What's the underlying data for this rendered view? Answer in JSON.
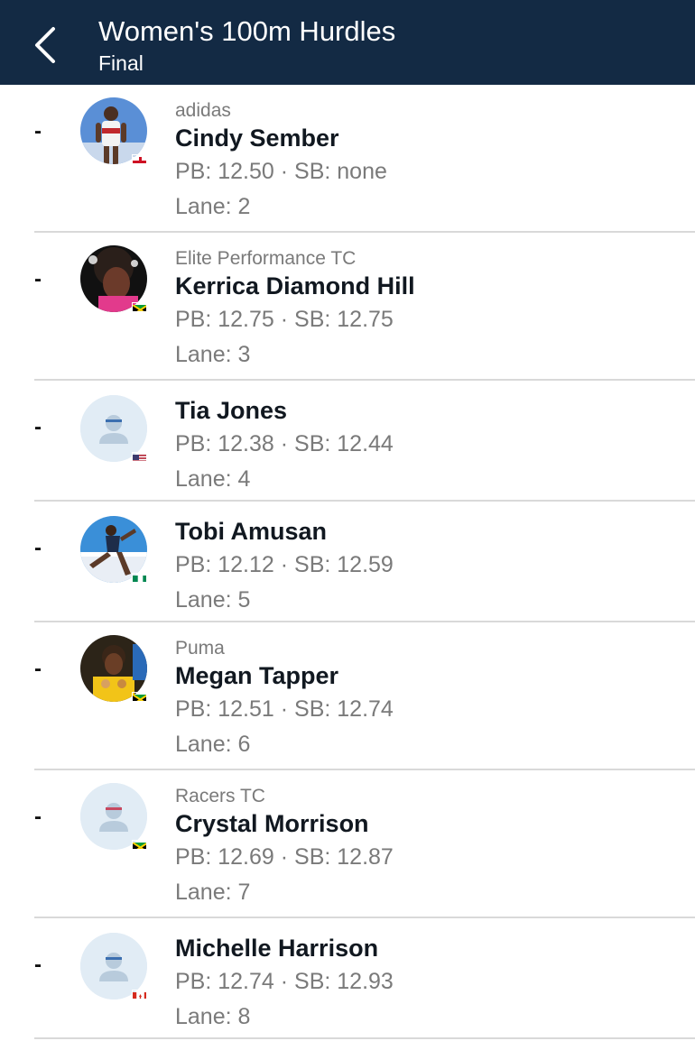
{
  "header": {
    "title": "Women's 100m Hurdles",
    "subtitle": "Final",
    "background": "#132a44"
  },
  "athletes": [
    {
      "rank": "-",
      "club": "adidas",
      "name": "Cindy Sember",
      "stats": "PB: 12.50 · SB: none",
      "lane": "Lane: 2",
      "country_flag": "england-flag-icon"
    },
    {
      "rank": "-",
      "club": "Elite Performance TC",
      "name": "Kerrica Diamond Hill",
      "stats": "PB: 12.75 · SB: 12.75",
      "lane": "Lane: 3",
      "country_flag": "jamaica-flag-icon"
    },
    {
      "rank": "-",
      "club": "",
      "name": "Tia Jones",
      "stats": "PB: 12.38 · SB: 12.44",
      "lane": "Lane: 4",
      "country_flag": "usa-flag-icon"
    },
    {
      "rank": "-",
      "club": "",
      "name": "Tobi Amusan",
      "stats": "PB: 12.12 · SB: 12.59",
      "lane": "Lane: 5",
      "country_flag": "nigeria-flag-icon"
    },
    {
      "rank": "-",
      "club": "Puma",
      "name": "Megan Tapper",
      "stats": "PB: 12.51 · SB: 12.74",
      "lane": "Lane: 6",
      "country_flag": "jamaica-flag-icon"
    },
    {
      "rank": "-",
      "club": "Racers TC",
      "name": "Crystal Morrison",
      "stats": "PB: 12.69 · SB: 12.87",
      "lane": "Lane: 7",
      "country_flag": "jamaica-flag-icon"
    },
    {
      "rank": "-",
      "club": "",
      "name": "Michelle Harrison",
      "stats": "PB: 12.74 · SB: 12.93",
      "lane": "Lane: 8",
      "country_flag": "canada-flag-icon"
    }
  ]
}
